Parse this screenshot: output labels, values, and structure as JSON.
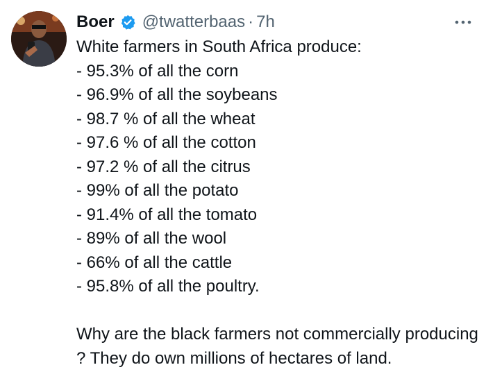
{
  "tweet": {
    "author": {
      "display_name": "Boer",
      "handle": "@twatterbaas",
      "separator": "·",
      "time": "7h",
      "avatar_icon": "profile-photo",
      "verified_icon": "verified-badge-icon",
      "verified_color": "#1d9bf0"
    },
    "more_icon": "more-horizontal-icon",
    "text": {
      "intro": "White farmers in South Africa produce:",
      "items": [
        "- 95.3% of all the corn",
        "- 96.9% of all the soybeans",
        "- 98.7 % of all the wheat",
        "- 97.6 % of all the cotton",
        "- 97.2 % of all the citrus",
        "- 99% of all the potato",
        "- 91.4% of all the tomato",
        "- 89% of all the wool",
        "- 66% of all the cattle",
        "- 95.8% of all the poultry."
      ],
      "closing": "Why are the black farmers not commercially producing ? They do own millions of hectares of land."
    }
  }
}
